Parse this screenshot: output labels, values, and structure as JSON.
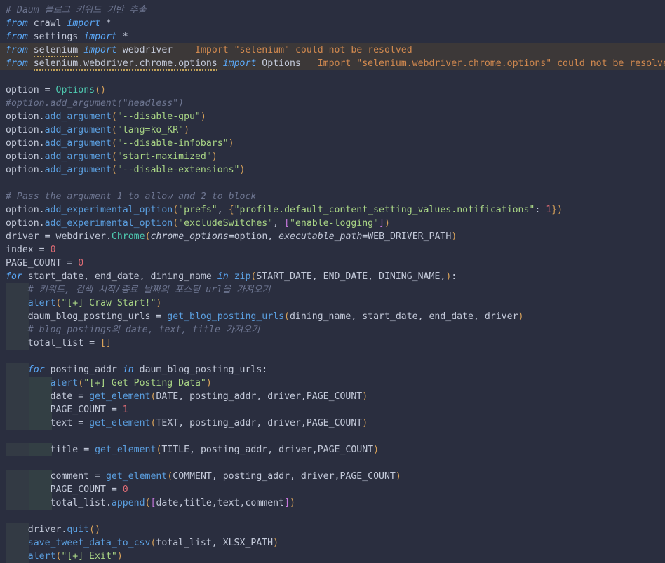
{
  "editor": {
    "language": "python",
    "theme": "dark-plus-variant",
    "background_color": "#2a2e3f",
    "error_line_highlight_color": "#3c3838",
    "indent_guide_color": "#4a5670"
  },
  "diagnostics": [
    {
      "line": 3,
      "message": "Import \"selenium\" could not be resolved",
      "severity": "warning",
      "color": "#d1894f"
    },
    {
      "line": 4,
      "message": "Import \"selenium.webdriver.chrome.options\" could not be resolved",
      "severity": "warning",
      "color": "#d1894f"
    }
  ],
  "code": {
    "l01_comment": "# Daum 블로그 키워드 기반 추출",
    "l02": {
      "from": "from",
      "mod": "crawl",
      "import": "import",
      "what": "*"
    },
    "l03": {
      "from": "from",
      "mod": "settings",
      "import": "import",
      "what": "*"
    },
    "l04": {
      "from": "from",
      "mod": "selenium",
      "import": "import",
      "what": "webdriver"
    },
    "l05": {
      "from": "from",
      "mod": "selenium.webdriver.chrome.options",
      "import": "import",
      "what": "Options"
    },
    "l07": {
      "var": "option",
      "eq": "=",
      "call": "Options",
      "open": "(",
      "close": ")"
    },
    "l08_comment": "#option.add_argument(\"headless\")",
    "l09": {
      "obj": "option",
      "dot": ".",
      "method": "add_argument",
      "arg": "\"--disable-gpu\""
    },
    "l10": {
      "obj": "option",
      "dot": ".",
      "method": "add_argument",
      "arg": "\"lang=ko_KR\""
    },
    "l11": {
      "obj": "option",
      "dot": ".",
      "method": "add_argument",
      "arg": "\"--disable-infobars\""
    },
    "l12": {
      "obj": "option",
      "dot": ".",
      "method": "add_argument",
      "arg": "\"start-maximized\""
    },
    "l13": {
      "obj": "option",
      "dot": ".",
      "method": "add_argument",
      "arg": "\"--disable-extensions\""
    },
    "l15_comment": "# Pass the argument 1 to allow and 2 to block",
    "l16": {
      "obj": "option",
      "method": "add_experimental_option",
      "arg1": "\"prefs\"",
      "dict_key": "\"profile.default_content_setting_values.notifications\"",
      "dict_val": "1"
    },
    "l17": {
      "obj": "option",
      "method": "add_experimental_option",
      "arg1": "\"excludeSwitches\"",
      "list_item": "\"enable-logging\""
    },
    "l18": {
      "var": "driver",
      "mod": "webdriver",
      "cls": "Chrome",
      "kw1": "chrome_options",
      "val1": "option",
      "kw2": "executable_path",
      "val2": "WEB_DRIVER_PATH"
    },
    "l19": {
      "var": "index",
      "eq": "=",
      "val": "0"
    },
    "l20": {
      "var": "PAGE_COUNT",
      "eq": "=",
      "val": "0"
    },
    "l21": {
      "for": "for",
      "targets": "start_date, end_date, dining_name",
      "in": "in",
      "iter_fn": "zip",
      "args": "START_DATE, END_DATE, DINING_NAME,"
    },
    "l22_comment": "# 키워드, 검색 시작/종료 날짜의 포스팅 url을 가져오기",
    "l23": {
      "fn": "alert",
      "arg": "\"[+] Craw Start!\""
    },
    "l24": {
      "var": "daum_blog_posting_urls",
      "eq": "=",
      "fn": "get_blog_posting_urls",
      "args": "dining_name, start_date, end_date, driver"
    },
    "l25_comment": "# blog_postings의 date, text, title 가져오기",
    "l26": {
      "var": "total_list",
      "eq": "=",
      "val": "[]"
    },
    "l28": {
      "for": "for",
      "target": "posting_addr",
      "in": "in",
      "iter": "daum_blog_posting_urls"
    },
    "l29": {
      "fn": "alert",
      "arg": "\"[+] Get Posting Data\""
    },
    "l30": {
      "var": "date",
      "eq": "=",
      "fn": "get_element",
      "args": "DATE, posting_addr, driver,PAGE_COUNT"
    },
    "l31": {
      "var": "PAGE_COUNT",
      "eq": "=",
      "val": "1"
    },
    "l32": {
      "var": "text",
      "eq": "=",
      "fn": "get_element",
      "args": "TEXT, posting_addr, driver,PAGE_COUNT"
    },
    "l34": {
      "var": "title",
      "eq": "=",
      "fn": "get_element",
      "args": "TITLE, posting_addr, driver,PAGE_COUNT"
    },
    "l36": {
      "var": "comment",
      "eq": "=",
      "fn": "get_element",
      "args": "COMMENT, posting_addr, driver,PAGE_COUNT"
    },
    "l37": {
      "var": "PAGE_COUNT",
      "eq": "=",
      "val": "0"
    },
    "l38": {
      "obj": "total_list",
      "method": "append",
      "args": "date,title,text,comment"
    },
    "l40": {
      "obj": "driver",
      "method": "quit"
    },
    "l41": {
      "fn": "save_tweet_data_to_csv",
      "args": "total_list, XLSX_PATH"
    },
    "l42": {
      "fn": "alert",
      "arg": "\"[+] Exit\""
    }
  }
}
